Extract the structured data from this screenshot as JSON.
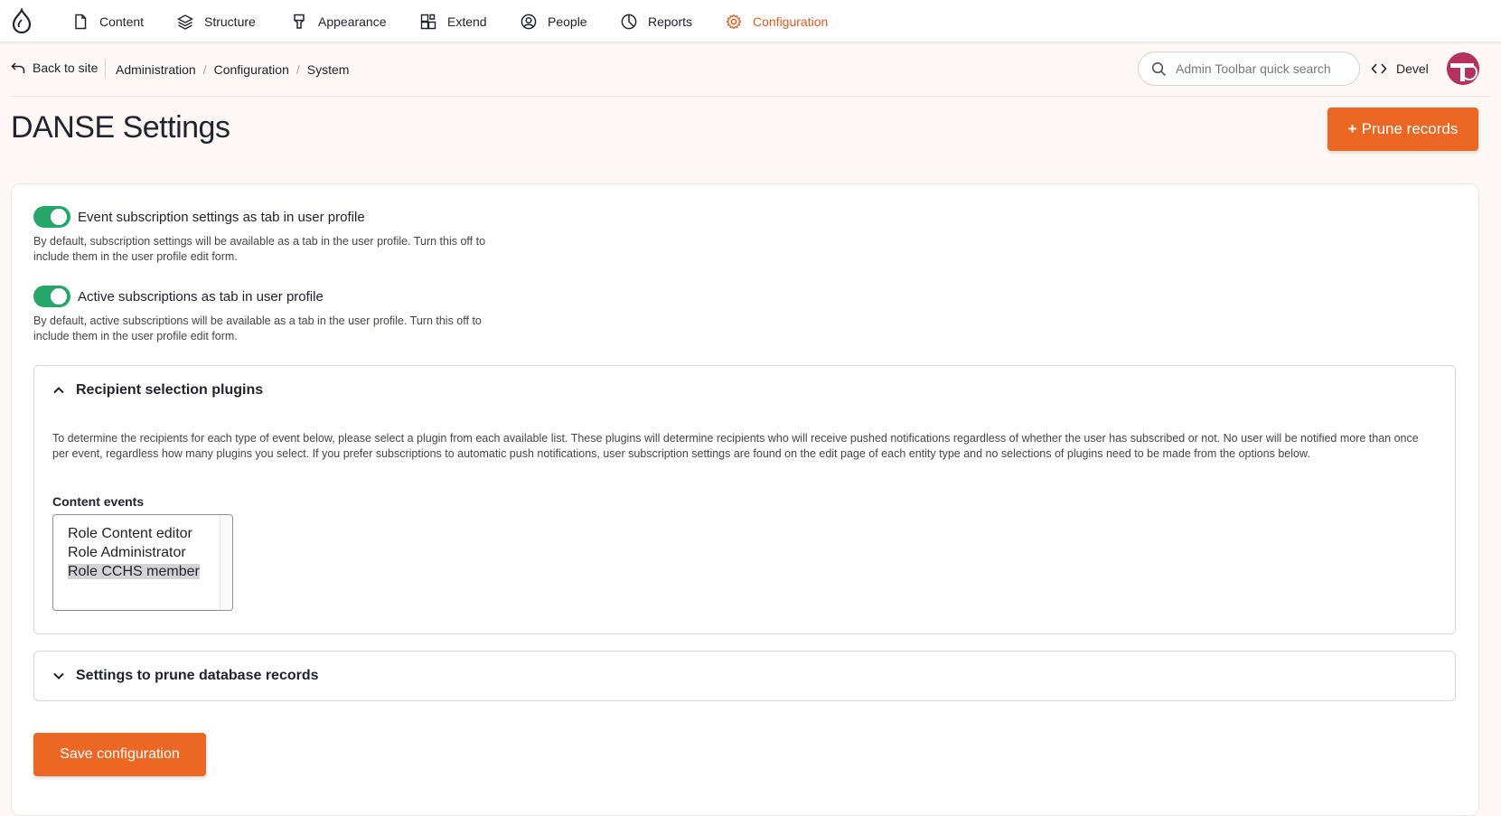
{
  "toolbar": {
    "items": [
      {
        "label": "Content",
        "icon": "file-icon"
      },
      {
        "label": "Structure",
        "icon": "layers-icon"
      },
      {
        "label": "Appearance",
        "icon": "brush-icon"
      },
      {
        "label": "Extend",
        "icon": "puzzle-icon"
      },
      {
        "label": "People",
        "icon": "user-circle-icon"
      },
      {
        "label": "Reports",
        "icon": "pie-chart-icon"
      },
      {
        "label": "Configuration",
        "icon": "gear-icon",
        "active": true
      }
    ],
    "accent_color": "#e8591a"
  },
  "subbar": {
    "back_label": "Back to site",
    "breadcrumb": [
      "Administration",
      "Configuration",
      "System"
    ],
    "search_placeholder": "Admin Toolbar quick search",
    "devel_label": "Devel"
  },
  "page": {
    "title": "DANSE Settings",
    "prune_button": "Prune records",
    "prune_plus": "+"
  },
  "settings": {
    "toggle1": {
      "label": "Event subscription settings as tab in user profile",
      "enabled": true,
      "description": "By default, subscription settings will be available as a tab in the user profile. Turn this off to include them in the user profile edit form."
    },
    "toggle2": {
      "label": "Active subscriptions as tab in user profile",
      "enabled": true,
      "description": "By default, active subscriptions will be available as a tab in the user profile. Turn this off to include them in the user profile edit form."
    },
    "recipient_section": {
      "title": "Recipient selection plugins",
      "expanded": true,
      "description": "To determine the recipients for each type of event below, please select a plugin from each available list. These plugins will determine recipients who will receive pushed notifications regardless of whether the user has subscribed or not. No user will be notified more than once per event, regardless how many plugins you select. If you prefer subscriptions to automatic push notifications, user subscription settings are found on the edit page of each entity type and no selections of plugins need to be made from the options below.",
      "content_events_label": "Content events",
      "options": [
        "Role Content editor",
        "Role Administrator",
        "Role CCHS member"
      ],
      "selected": "Role CCHS member"
    },
    "prune_section": {
      "title": "Settings to prune database records",
      "expanded": false
    },
    "save_button": "Save configuration"
  },
  "colors": {
    "primary_button": "#ed6724",
    "toggle_on": "#26a769"
  }
}
